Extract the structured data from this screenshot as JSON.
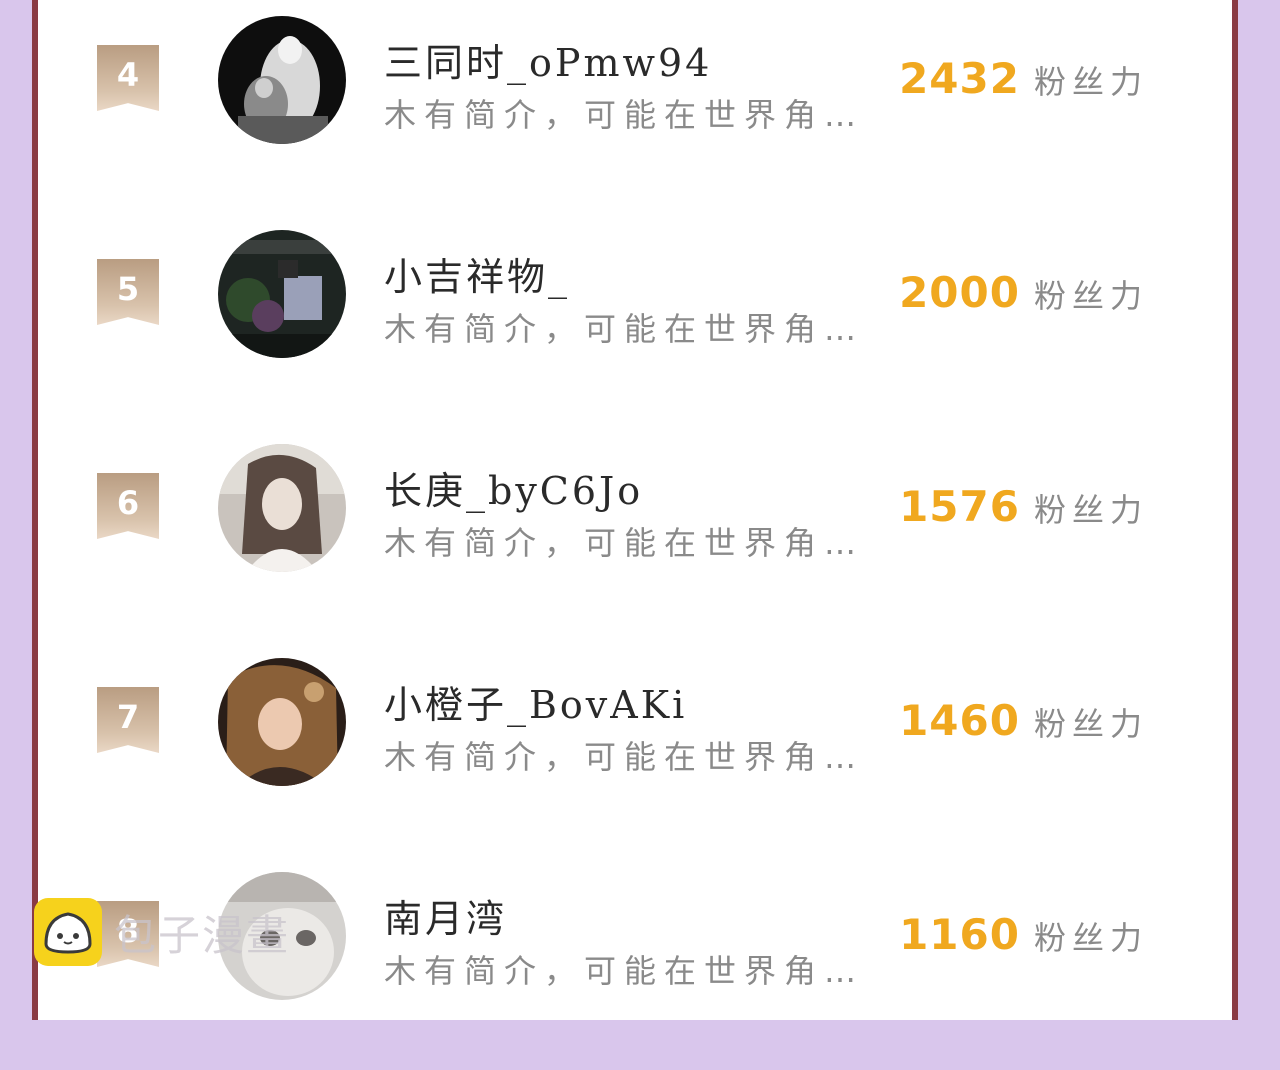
{
  "rows": [
    {
      "rank": "4",
      "name": "三同时_oPmw94",
      "bio": "木有简介，可能在世界角…",
      "fans_value": "2432",
      "fans_unit": "粉丝力"
    },
    {
      "rank": "5",
      "name": "小吉祥物_",
      "bio": "木有简介，可能在世界角…",
      "fans_value": "2000",
      "fans_unit": "粉丝力"
    },
    {
      "rank": "6",
      "name": "长庚_byC6Jo",
      "bio": "木有简介，可能在世界角…",
      "fans_value": "1576",
      "fans_unit": "粉丝力"
    },
    {
      "rank": "7",
      "name": "小橙子_BovAKi",
      "bio": "木有简介，可能在世界角…",
      "fans_value": "1460",
      "fans_unit": "粉丝力"
    },
    {
      "rank": "8",
      "name": "南月湾",
      "bio": "木有简介，可能在世界角…",
      "fans_value": "1160",
      "fans_unit": "粉丝力"
    }
  ],
  "watermark": {
    "text": "包子漫畫"
  },
  "colors": {
    "accent": "#f0a81f",
    "frame": "#8a3b44",
    "background": "#d9c6ec",
    "rank_badge": "#c8ad92"
  }
}
